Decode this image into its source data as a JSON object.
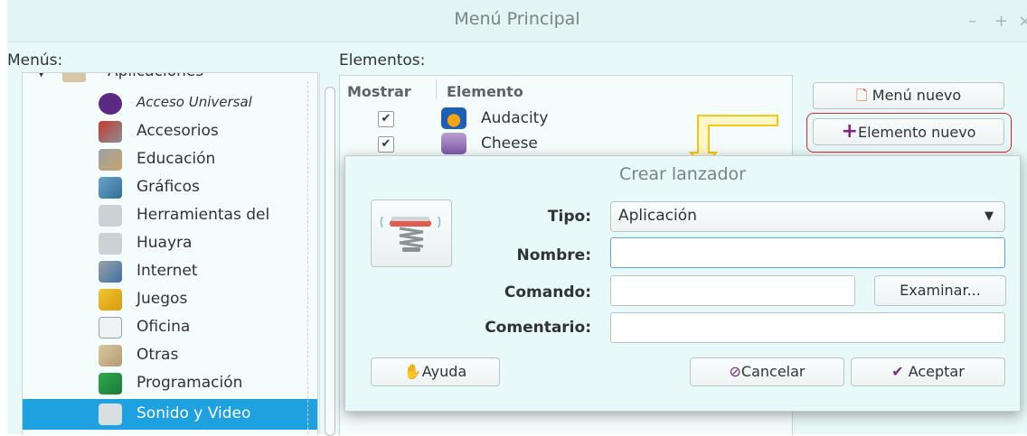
{
  "window": {
    "title": "Menú Principal",
    "controls": [
      "–",
      "+",
      "×"
    ]
  },
  "left_panel": {
    "label": "Menús:",
    "root_item": "Aplicaciones",
    "items": [
      {
        "label": "Acceso Universal",
        "icon": "accessibility-icon",
        "italic": true
      },
      {
        "label": "Accesorios",
        "icon": "accessories-icon"
      },
      {
        "label": "Educación",
        "icon": "education-icon"
      },
      {
        "label": "Gráficos",
        "icon": "graphics-icon"
      },
      {
        "label": "Herramientas del",
        "icon": "tools-icon"
      },
      {
        "label": "Huayra",
        "icon": "huayra-icon"
      },
      {
        "label": "Internet",
        "icon": "internet-icon"
      },
      {
        "label": "Juegos",
        "icon": "games-icon"
      },
      {
        "label": "Oficina",
        "icon": "office-icon"
      },
      {
        "label": "Otras",
        "icon": "other-icon"
      },
      {
        "label": "Programación",
        "icon": "programming-icon"
      },
      {
        "label": "Sonido y Video",
        "icon": "multimedia-icon",
        "selected": true
      }
    ]
  },
  "elements_panel": {
    "label": "Elementos:",
    "columns": [
      "Mostrar",
      "Elemento"
    ],
    "rows": [
      {
        "checked": true,
        "label": "Audacity",
        "icon": "audacity-icon"
      },
      {
        "checked": true,
        "label": "Cheese",
        "icon": "cheese-icon"
      }
    ]
  },
  "actions": {
    "new_menu": "Menú nuevo",
    "new_item": "Elemento nuevo"
  },
  "dialog": {
    "title": "Crear lanzador",
    "tipo_label": "Tipo:",
    "tipo_value": "Aplicación",
    "nombre_label": "Nombre:",
    "nombre_value": "",
    "comando_label": "Comando:",
    "comando_value": "",
    "comentario_label": "Comentario:",
    "comentario_value": "",
    "examinar": "Examinar...",
    "ayuda": "Ayuda",
    "cancelar": "Cancelar",
    "aceptar": "Aceptar"
  },
  "colors": {
    "selection": "#1fa0df",
    "highlight_box": "#e0242a",
    "annotation_arrow": "#f5c518"
  }
}
